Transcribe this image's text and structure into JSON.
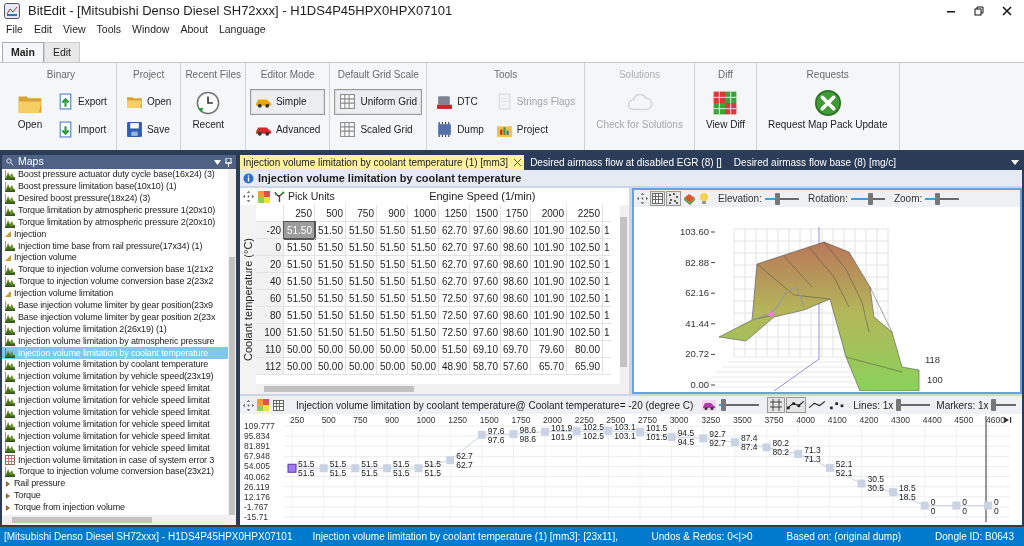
{
  "window": {
    "title": "BitEdit - [Mitsubishi Denso Diesel SH72xxx] - H1DS4P45HPX0HPX07101"
  },
  "menu": [
    "File",
    "Edit",
    "View",
    "Tools",
    "Window",
    "About",
    "Language"
  ],
  "ribbon_tabs": [
    {
      "label": "Main",
      "selected": true
    },
    {
      "label": "Edit",
      "selected": false
    }
  ],
  "ribbon_groups": [
    {
      "title": "Binary",
      "disabled": false,
      "columns": [
        [
          {
            "label": "Open",
            "kind": "large",
            "disabled": false
          }
        ],
        [
          {
            "label": "Export",
            "kind": "small",
            "disabled": false
          },
          {
            "label": "Import",
            "kind": "small",
            "disabled": false
          }
        ]
      ]
    },
    {
      "title": "Project",
      "disabled": false,
      "columns": [
        [
          {
            "label": "Open",
            "kind": "small",
            "disabled": false
          },
          {
            "label": "Save",
            "kind": "small",
            "disabled": false
          }
        ]
      ]
    },
    {
      "title": "Recent Files",
      "disabled": false,
      "columns": [
        [
          {
            "label": "Recent",
            "kind": "large",
            "disabled": false
          }
        ]
      ]
    },
    {
      "title": "Editor Mode",
      "disabled": false,
      "columns": [
        [
          {
            "label": "Simple",
            "kind": "small",
            "disabled": false,
            "selected": true
          },
          {
            "label": "Advanced",
            "kind": "small",
            "disabled": false,
            "selected": false
          }
        ]
      ]
    },
    {
      "title": "Default Grid Scale",
      "disabled": false,
      "columns": [
        [
          {
            "label": "Uniform Grid",
            "kind": "small",
            "disabled": false,
            "selected": true
          },
          {
            "label": "Scaled Grid",
            "kind": "small",
            "disabled": false,
            "selected": false
          }
        ]
      ]
    },
    {
      "title": "Tools",
      "disabled": false,
      "columns": [
        [
          {
            "label": "DTC",
            "kind": "small",
            "disabled": false
          },
          {
            "label": "Dump",
            "kind": "small",
            "disabled": false
          }
        ],
        [
          {
            "label": "Strings Flags",
            "kind": "small",
            "disabled": true
          },
          {
            "label": "Project",
            "kind": "small",
            "disabled": false
          }
        ]
      ]
    },
    {
      "title": "Solutions",
      "disabled": true,
      "columns": [
        [
          {
            "label": "Check for Solutions",
            "kind": "large",
            "disabled": true
          }
        ]
      ]
    },
    {
      "title": "Diff",
      "disabled": false,
      "columns": [
        [
          {
            "label": "View Diff",
            "kind": "large",
            "disabled": false
          }
        ]
      ]
    },
    {
      "title": "Requests",
      "disabled": false,
      "columns": [
        [
          {
            "label": "Request Map Pack Update",
            "kind": "large",
            "disabled": false
          }
        ]
      ]
    }
  ],
  "maps_panel": {
    "title": "Maps",
    "tree": [
      {
        "kind": "map",
        "label": "Boost pressure actuator duty cycle base(16x24) (3)",
        "selected": false
      },
      {
        "kind": "map",
        "label": "Boost pressure limitation base(10x10) (1)",
        "selected": false
      },
      {
        "kind": "map",
        "label": "Desired boost pressure(18x24) (3)",
        "selected": false
      },
      {
        "kind": "map",
        "label": "Torque limitation by atmospheric pressure 1(20x10)",
        "selected": false
      },
      {
        "kind": "map",
        "label": "Torque limitation by atmospheric pressure 2(20x10)",
        "selected": false
      },
      {
        "kind": "group",
        "label": "Injection",
        "expanded": true,
        "selected": false,
        "children": [
          {
            "kind": "map",
            "label": "Injection time base from rail pressure(17x34) (1)",
            "selected": false
          }
        ]
      },
      {
        "kind": "group",
        "label": "Injection volume",
        "expanded": true,
        "selected": false,
        "children": [
          {
            "kind": "map",
            "label": "Torque to injection volume conversion base 1(21x2",
            "selected": false
          },
          {
            "kind": "map",
            "label": "Torque to injection volume conversion base 2(23x2",
            "selected": false
          }
        ]
      },
      {
        "kind": "group",
        "label": "Injection volume limitation",
        "expanded": true,
        "selected": false,
        "children": [
          {
            "kind": "map",
            "label": "Base injection volume limiter by gear position(23x9",
            "selected": false
          },
          {
            "kind": "map",
            "label": "Base injection volume limiter by gear position 2(23x",
            "selected": false
          },
          {
            "kind": "map",
            "label": "Injection volume limitation 2(26x19) (1)",
            "selected": false
          },
          {
            "kind": "map",
            "label": "Injection volume limitation by atmospheric pressure",
            "selected": false
          },
          {
            "kind": "map",
            "label": "Injection volume limitation by coolant temperature",
            "selected": true
          },
          {
            "kind": "map",
            "label": "Injection volume limitation by coolant temperature",
            "selected": false
          },
          {
            "kind": "map",
            "label": "Injection volume limitation by vehicle speed(23x19)",
            "selected": false
          },
          {
            "kind": "map",
            "label": "Injection volume limitation for vehicle speed limitat",
            "selected": false
          },
          {
            "kind": "map",
            "label": "Injection volume limitation for vehicle speed limitat",
            "selected": false
          },
          {
            "kind": "map",
            "label": "Injection volume limitation for vehicle speed limitat",
            "selected": false
          },
          {
            "kind": "map",
            "label": "Injection volume limitation for vehicle speed limitat",
            "selected": false
          },
          {
            "kind": "map",
            "label": "Injection volume limitation for vehicle speed limitat",
            "selected": false
          },
          {
            "kind": "map",
            "label": "Injection volume limitation for vehicle speed limitat",
            "selected": false
          },
          {
            "kind": "table",
            "label": "Injection volume limitation in case of system error 3",
            "selected": false
          },
          {
            "kind": "map",
            "label": "Torque to injection volume conversion base(23x21)",
            "selected": false
          }
        ]
      },
      {
        "kind": "group",
        "label": "Rail pressure",
        "expanded": false,
        "selected": false
      },
      {
        "kind": "group",
        "label": "Torque",
        "expanded": false,
        "selected": false
      },
      {
        "kind": "group",
        "label": "Torque from injection volume",
        "expanded": false,
        "selected": false
      }
    ]
  },
  "documents": {
    "tabs": [
      {
        "label": "Injection volume limitation by coolant temperature (1) [mm3]",
        "selected": true
      },
      {
        "label": "Desired airmass flow at disabled EGR (8) []",
        "selected": false
      },
      {
        "label": "Desired airmass flow base (8) [mg/c]",
        "selected": false
      }
    ],
    "title": "Injection volume limitation by coolant temperature"
  },
  "table": {
    "pick_units": "Pick Units",
    "column_axis": "Engine Speed (1/min)",
    "row_axis": "Coolant temperature (°C)",
    "columns": [
      {
        "label": "250",
        "selected": true
      },
      {
        "label": "500",
        "selected": false
      },
      {
        "label": "750",
        "selected": false
      },
      {
        "label": "900",
        "selected": false
      },
      {
        "label": "1000",
        "selected": false
      },
      {
        "label": "1250",
        "selected": false
      },
      {
        "label": "1500",
        "selected": false
      },
      {
        "label": "1750",
        "selected": false
      },
      {
        "label": "2000",
        "selected": false
      },
      {
        "label": "2250",
        "selected": false
      }
    ],
    "rows": [
      {
        "label": "-20",
        "selected": true,
        "cells": [
          "51.50",
          "51.50",
          "51.50",
          "51.50",
          "51.50",
          "62.70",
          "97.60",
          "98.60",
          "101.90",
          "102.50",
          "1"
        ]
      },
      {
        "label": "0",
        "selected": false,
        "cells": [
          "51.50",
          "51.50",
          "51.50",
          "51.50",
          "51.50",
          "62.70",
          "97.60",
          "98.60",
          "101.90",
          "102.50",
          "1"
        ]
      },
      {
        "label": "20",
        "selected": false,
        "cells": [
          "51.50",
          "51.50",
          "51.50",
          "51.50",
          "51.50",
          "62.70",
          "97.60",
          "98.60",
          "101.90",
          "102.50",
          "1"
        ]
      },
      {
        "label": "40",
        "selected": false,
        "cells": [
          "51.50",
          "51.50",
          "51.50",
          "51.50",
          "51.50",
          "62.70",
          "97.60",
          "98.60",
          "101.90",
          "102.50",
          "1"
        ]
      },
      {
        "label": "60",
        "selected": false,
        "cells": [
          "51.50",
          "51.50",
          "51.50",
          "51.50",
          "51.50",
          "72.50",
          "97.60",
          "98.60",
          "101.90",
          "102.50",
          "1"
        ]
      },
      {
        "label": "80",
        "selected": false,
        "cells": [
          "51.50",
          "51.50",
          "51.50",
          "51.50",
          "51.50",
          "72.50",
          "97.60",
          "98.60",
          "101.90",
          "102.50",
          "1"
        ]
      },
      {
        "label": "100",
        "selected": false,
        "cells": [
          "51.50",
          "51.50",
          "51.50",
          "51.50",
          "51.50",
          "72.50",
          "97.60",
          "98.60",
          "101.90",
          "102.50",
          "1"
        ]
      },
      {
        "label": "110",
        "selected": false,
        "cells": [
          "50.00",
          "50.00",
          "50.00",
          "50.00",
          "50.00",
          "51.50",
          "69.10",
          "69.70",
          "79.60",
          "80.00"
        ]
      },
      {
        "label": "112",
        "selected": false,
        "cells": [
          "50.00",
          "50.00",
          "50.00",
          "50.00",
          "50.00",
          "48.90",
          "58.70",
          "57.60",
          "65.70",
          "65.90"
        ]
      }
    ]
  },
  "surface_plot": {
    "controls": [
      {
        "label": "Elevation:",
        "level": 0.35
      },
      {
        "label": "Rotation:",
        "level": 0.55
      },
      {
        "label": "Zoom:",
        "level": 0.35
      }
    ],
    "z_ticks": [
      "103.60",
      "82.88",
      "62.16",
      "41.44",
      "20.72",
      "0.00"
    ],
    "depth_ticks": [
      "118",
      "100"
    ]
  },
  "line_chart": {
    "title": "Injection volume limitation by coolant temperature@ Coolant temperature= -20 (degree C)",
    "zoom_slider": {
      "level": 0.1
    },
    "grid_toggle": {
      "on": true
    },
    "line_modes": [
      {
        "kind": "line-markers",
        "selected": true
      },
      {
        "kind": "line",
        "selected": false
      },
      {
        "kind": "markers",
        "selected": false
      }
    ],
    "sliders": [
      {
        "label": "Lines: 1x",
        "level": 0.05
      },
      {
        "label": "Markers: 1x",
        "level": 0.05
      }
    ],
    "chart_data": {
      "type": "line",
      "grid": true,
      "categories": [
        "250",
        "500",
        "750",
        "900",
        "1000",
        "1250",
        "1500",
        "1750",
        "2000",
        "2250",
        "2500",
        "2750",
        "3000",
        "3250",
        "3500",
        "3750",
        "4000",
        "4100",
        "4200",
        "4300",
        "4400",
        "4500",
        "4600"
      ],
      "series": [
        {
          "color": "#c9d3e3",
          "marker": "square",
          "values": [
            51.5,
            51.5,
            51.5,
            51.5,
            51.5,
            62.7,
            97.6,
            98.6,
            101.9,
            102.5,
            103.1,
            101.5,
            94.5,
            92.7,
            87.4,
            80.2,
            71.3,
            52.1,
            30.5,
            18.5,
            0,
            0,
            0
          ]
        }
      ],
      "ylim": [
        -15.71,
        109.777
      ],
      "yticks": [
        109.777,
        95.834,
        81.891,
        67.948,
        54.005,
        40.062,
        26.119,
        12.176,
        -1.767,
        -15.71
      ],
      "data_labels": true,
      "value_labels": [
        "51.5",
        "51.5",
        "51.5",
        "51.5",
        "51.5",
        "62.7",
        "97.6",
        "98.6",
        "101.9",
        "102.5",
        "103.1",
        "101.5",
        "94.5",
        "92.7",
        "87.4",
        "80.2",
        "71.3",
        "52.1",
        "30.5",
        "18.5",
        "0",
        "0",
        "0"
      ],
      "ref_lines": [
        {
          "axis": "x",
          "value": "4600",
          "color": "#333333"
        }
      ]
    }
  },
  "status_bar": {
    "left": [
      "[Mitsubishi Denso Diesel SH72xxx] - H1DS4P45HPX0HPX07101",
      "Injection volume limitation by coolant temperature (1) [mm3]: [23x11],"
    ],
    "right": [
      "Undos & Redos: 0<|>0",
      "Based on: (original dump)",
      "Dongle ID: B0643"
    ]
  }
}
